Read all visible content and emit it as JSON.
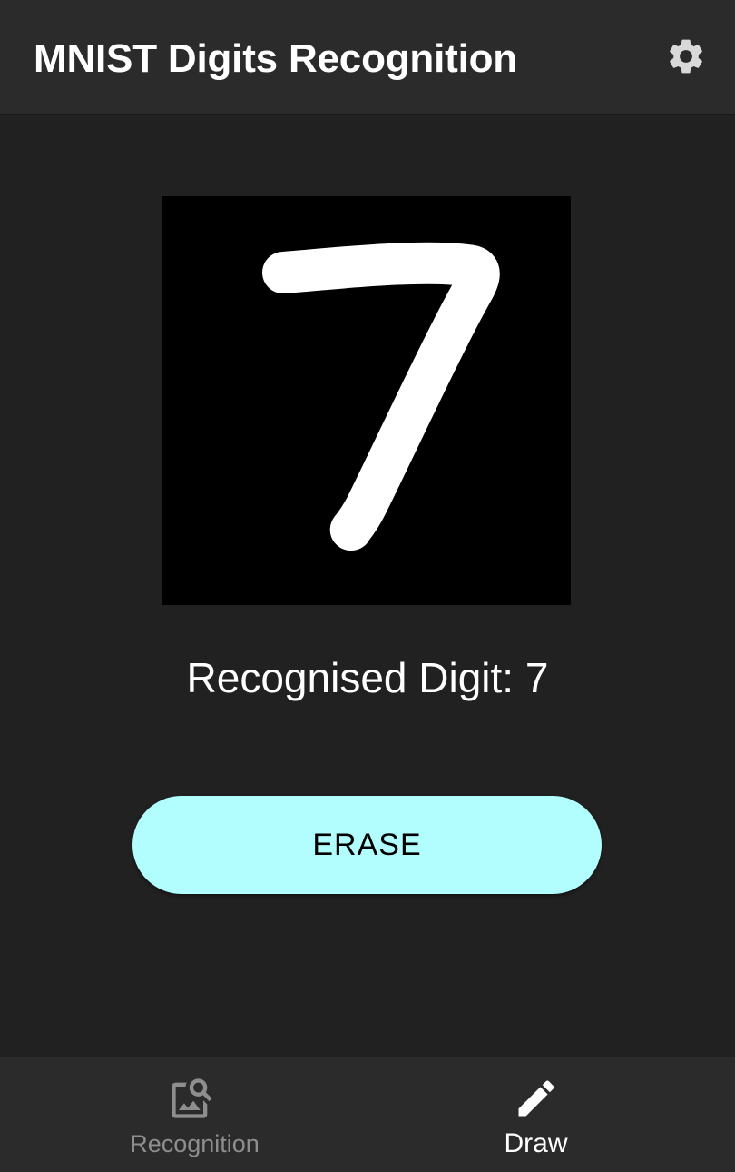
{
  "app_bar": {
    "title": "MNIST Digits Recognition",
    "settings_icon": "gear-icon"
  },
  "canvas": {
    "background": "#000000",
    "stroke_color": "#ffffff"
  },
  "result": {
    "text": "Recognised Digit: 7"
  },
  "erase_button": {
    "label": "ERASE",
    "color": "#b2feff"
  },
  "bottom_nav": {
    "items": [
      {
        "label": "Recognition",
        "icon": "image-search-icon",
        "selected": false
      },
      {
        "label": "Draw",
        "icon": "pencil-icon",
        "selected": true
      }
    ],
    "active_color": "#ffffff",
    "inactive_color": "#8e8e8e"
  }
}
